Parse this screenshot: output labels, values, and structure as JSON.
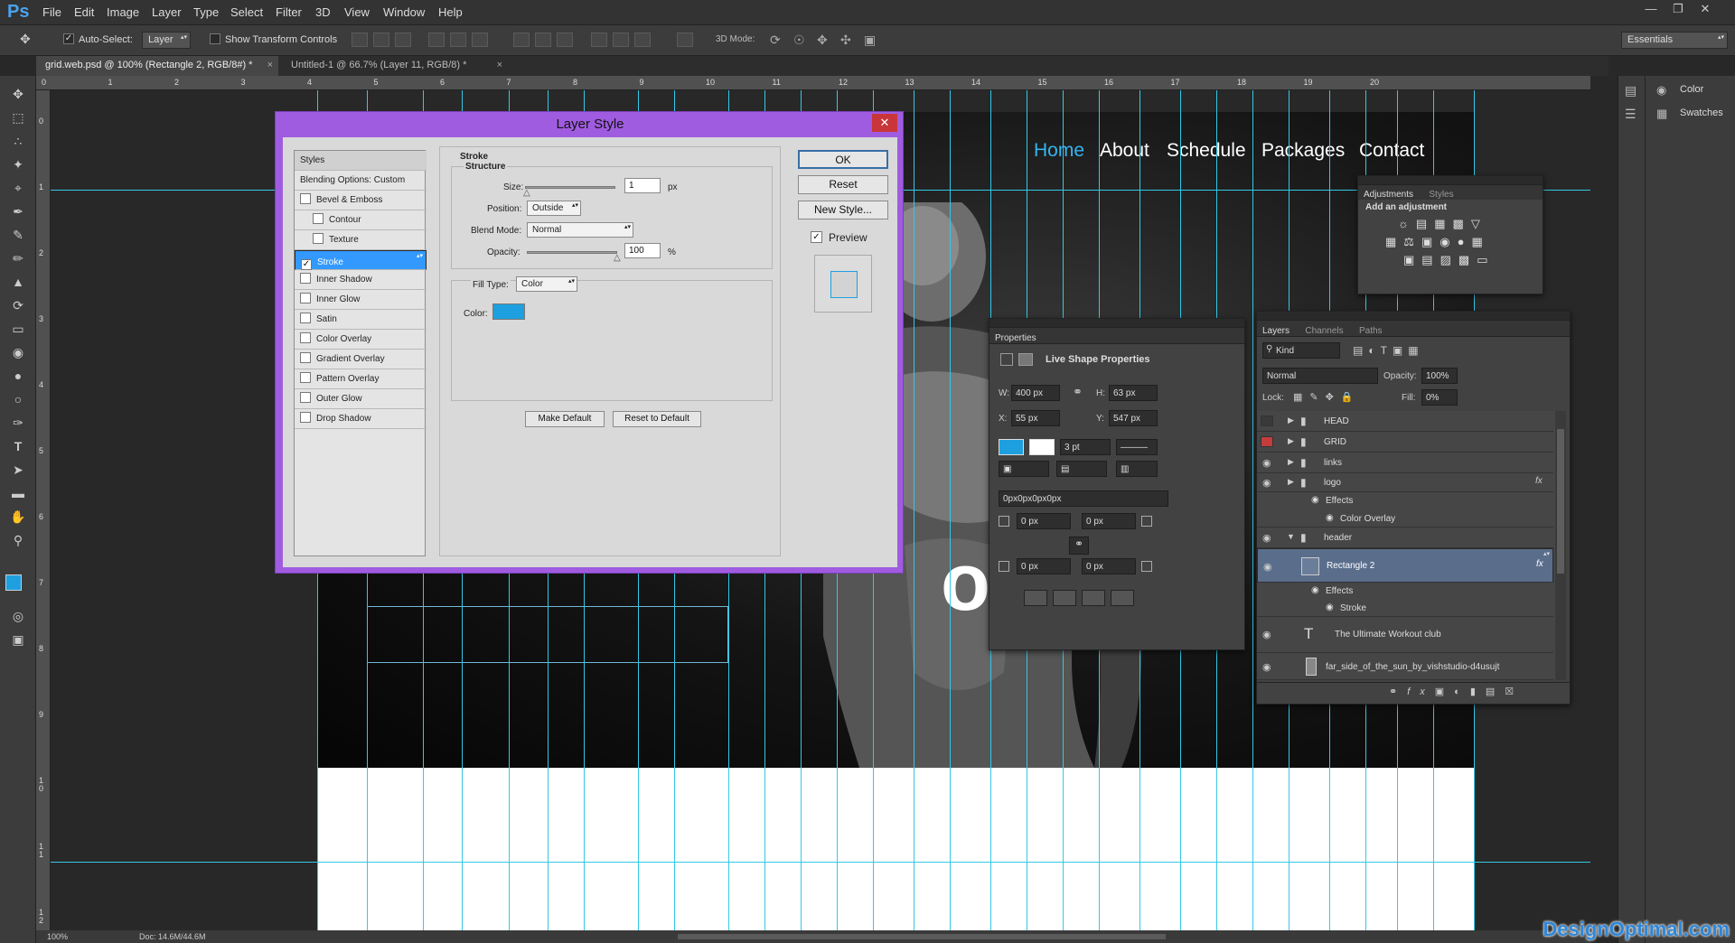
{
  "app": {
    "logo": "Ps"
  },
  "menu": [
    "File",
    "Edit",
    "Image",
    "Layer",
    "Type",
    "Select",
    "Filter",
    "3D",
    "View",
    "Window",
    "Help"
  ],
  "options_bar": {
    "auto_select_label": "Auto-Select:",
    "auto_select_value": "Layer",
    "show_transform_label": "Show Transform Controls",
    "mode_label": "3D Mode:",
    "workspace": "Essentials"
  },
  "tabs": [
    {
      "label": "grid.web.psd @ 100% (Rectangle 2, RGB/8#) *"
    },
    {
      "label": "Untitled-1 @ 66.7% (Layer 11, RGB/8) *"
    }
  ],
  "ruler_h": [
    "0",
    "1",
    "2",
    "3",
    "4",
    "5",
    "6",
    "7",
    "8",
    "9",
    "10",
    "11",
    "12",
    "13",
    "14",
    "15",
    "16",
    "17",
    "18",
    "19",
    "20"
  ],
  "ruler_v": [
    "0",
    "1",
    "2",
    "3",
    "4",
    "5",
    "6",
    "7",
    "8",
    "9",
    "1 0",
    "1 1",
    "1 2"
  ],
  "site": {
    "nav": [
      "Home",
      "About",
      "Schedule",
      "Packages",
      "Contact"
    ],
    "accent": "#34b4f0"
  },
  "dock": {
    "color": "Color",
    "swatches": "Swatches"
  },
  "adjustments": {
    "tab_active": "Adjustments",
    "tab_other": "Styles",
    "title": "Add an adjustment"
  },
  "properties": {
    "tab": "Properties",
    "title": "Live Shape Properties",
    "w_label": "W:",
    "w": "400 px",
    "h_label": "H:",
    "h": "63 px",
    "x_label": "X:",
    "x": "55 px",
    "y_label": "Y:",
    "y": "547 px",
    "stroke_size": "3 pt",
    "radius_text": "0px0px0px0px",
    "r1": "0 px",
    "r2": "0 px",
    "r3": "0 px",
    "r4": "0 px",
    "fill_color": "#1ea0e0"
  },
  "layers_panel": {
    "tabs": [
      "Layers",
      "Channels",
      "Paths"
    ],
    "kind": "Kind",
    "blend": "Normal",
    "opacity_label": "Opacity:",
    "opacity": "100%",
    "lock_label": "Lock:",
    "fill_label": "Fill:",
    "fill": "0%",
    "rows": [
      {
        "name": "HEAD"
      },
      {
        "name": "GRID"
      },
      {
        "name": "links"
      },
      {
        "name": "logo"
      },
      {
        "name": "Effects"
      },
      {
        "name": "Color Overlay"
      },
      {
        "name": "header"
      },
      {
        "name": "Rectangle 2"
      },
      {
        "name": "Effects"
      },
      {
        "name": "Stroke"
      },
      {
        "name": "The Ultimate   Workout club"
      },
      {
        "name": "far_side_of_the_sun_by_vishstudio-d4usujt"
      }
    ],
    "fx": "fx"
  },
  "dialog": {
    "title": "Layer Style",
    "styles_header": "Styles",
    "blending": "Blending Options: Custom",
    "styles": [
      "Bevel & Emboss",
      "Contour",
      "Texture",
      "Stroke",
      "Inner Shadow",
      "Inner Glow",
      "Satin",
      "Color Overlay",
      "Gradient Overlay",
      "Pattern Overlay",
      "Outer Glow",
      "Drop Shadow"
    ],
    "section": "Stroke",
    "structure": "Structure",
    "size_label": "Size:",
    "size_value": "1",
    "size_unit": "px",
    "position_label": "Position:",
    "position_value": "Outside",
    "blend_label": "Blend Mode:",
    "blend_value": "Normal",
    "opacity_label": "Opacity:",
    "opacity_value": "100",
    "opacity_unit": "%",
    "fill_type_label": "Fill Type:",
    "fill_type_value": "Color",
    "color_label": "Color:",
    "stroke_color": "#1ea0e0",
    "make_default": "Make Default",
    "reset_default": "Reset to Default",
    "ok": "OK",
    "reset": "Reset",
    "new_style": "New Style...",
    "preview": "Preview",
    "close": "✕"
  },
  "status": {
    "zoom": "100%",
    "doc": "Doc: 14.6M/44.6M"
  },
  "watermark": "DesignOptimal.com"
}
